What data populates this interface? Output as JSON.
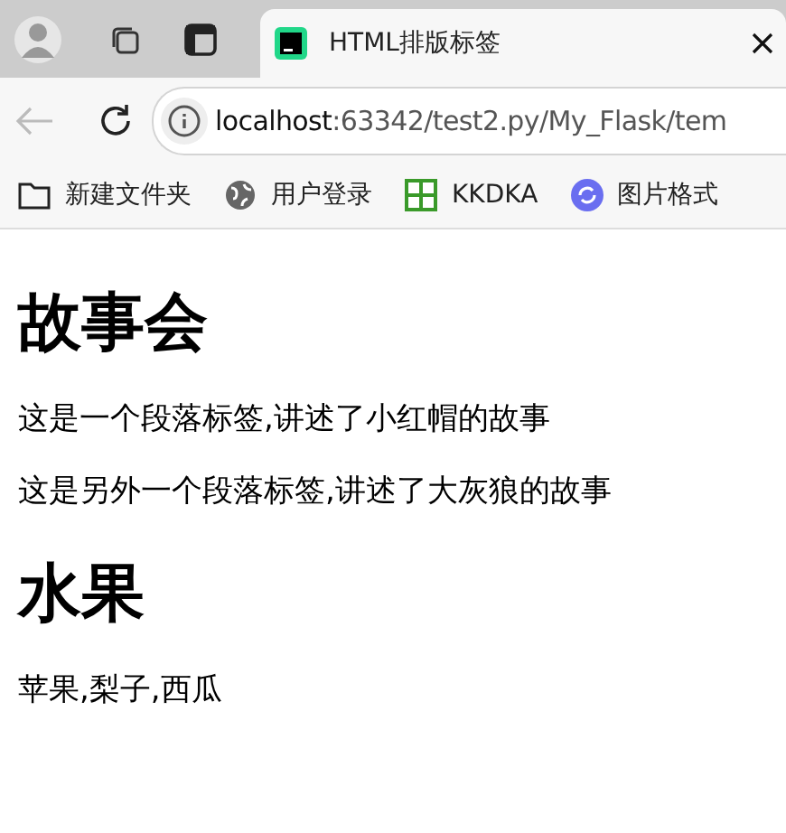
{
  "tab": {
    "title": "HTML排版标签",
    "selected": true
  },
  "address": {
    "host": "localhost",
    "path": ":63342/test2.py/My_Flask/tem"
  },
  "bookmarks": [
    {
      "kind": "folder",
      "label": "新建文件夹"
    },
    {
      "kind": "globe",
      "label": "用户登录"
    },
    {
      "kind": "grid",
      "label": "KKDKA"
    },
    {
      "kind": "sync",
      "label": "图片格式"
    }
  ],
  "content": [
    {
      "kind": "h1",
      "text": "故事会"
    },
    {
      "kind": "p",
      "text": "这是一个段落标签,讲述了小红帽的故事"
    },
    {
      "kind": "p",
      "text": "这是另外一个段落标签,讲述了大灰狼的故事"
    },
    {
      "kind": "h1",
      "text": "水果"
    },
    {
      "kind": "p",
      "text": "苹果,梨子,西瓜"
    }
  ]
}
